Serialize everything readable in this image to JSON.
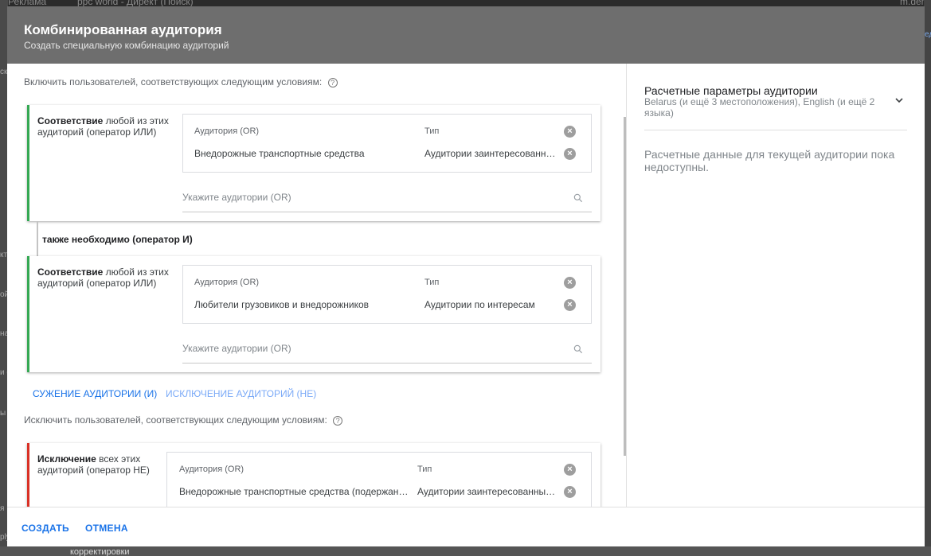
{
  "background": {
    "top_texts": [
      "Реклама",
      "ppc world - Директ (Поиск)",
      "m.dem"
    ],
    "left_texts": [
      "ск",
      "кт",
      "ой",
      "на",
      "и о",
      "ы о",
      "я",
      "ply"
    ],
    "right_text": "ед",
    "bottom_text": "корректировки"
  },
  "modal": {
    "title": "Комбинированная аудитория",
    "subtitle": "Создать специальную комбинацию аудиторий"
  },
  "include": {
    "label": "Включить пользователей, соответствующих следующим условиям:",
    "help_icon": "?",
    "groups": [
      {
        "label_bold": "Соответствие",
        "label_rest": " любой из этих аудиторий (оператор ИЛИ)",
        "col_audience": "Аудитория (OR)",
        "col_type": "Тип",
        "rows": [
          {
            "audience": "Внедорожные транспортные средства",
            "type": "Аудитории заинтересованных покупателей"
          }
        ],
        "search_placeholder": "Укажите аудитории (OR)"
      },
      {
        "label_bold": "Соответствие",
        "label_rest": " любой из этих аудиторий (оператор ИЛИ)",
        "col_audience": "Аудитория (OR)",
        "col_type": "Тип",
        "rows": [
          {
            "audience": "Любители грузовиков и внедорожников",
            "type": "Аудитории по интересам"
          }
        ],
        "search_placeholder": "Укажите аудитории (OR)"
      }
    ],
    "and_label": "также необходимо (оператор И)"
  },
  "actions": {
    "narrow": "СУЖЕНИЕ АУДИТОРИИ (И)",
    "exclude": "ИСКЛЮЧЕНИЕ АУДИТОРИЙ (НЕ)"
  },
  "exclude": {
    "label": "Исключить пользователей, соответствующих следующим условиям:",
    "help_icon": "?",
    "group": {
      "label_bold": "Исключение",
      "label_rest": " всех этих аудиторий (оператор НЕ)",
      "col_audience": "Аудитория (OR)",
      "col_type": "Тип",
      "rows": [
        {
          "audience": "Внедорожные транспортные средства (подержанные)",
          "type": "Аудитории заинтересованных покупателей"
        }
      ]
    }
  },
  "estimates": {
    "title": "Расчетные параметры аудитории",
    "subtitle": "Belarus (и ещё 3 местоположения), English (и ещё 2 языка)",
    "empty": "Расчетные данные для текущей аудитории пока недоступны."
  },
  "footer": {
    "create": "СОЗДАТЬ",
    "cancel": "ОТМЕНА"
  },
  "colors": {
    "accent": "#1a73e8",
    "accent_light": "#7baaf7",
    "include_border": "#34a853",
    "exclude_border": "#d93025",
    "header_bg": "#6e6e6e"
  },
  "icons": {
    "remove": "×",
    "search": "search-icon",
    "expand": "chevron-down-icon"
  }
}
